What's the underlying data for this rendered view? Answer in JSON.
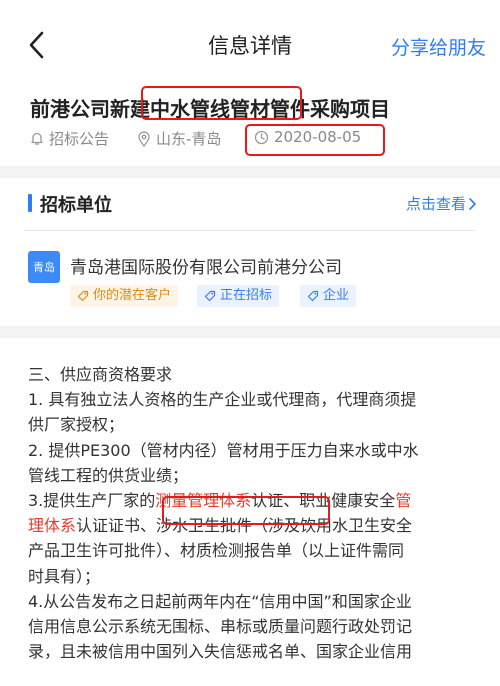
{
  "header": {
    "title": "信息详情",
    "share_label": "分享给朋友"
  },
  "project": {
    "title_part1": "前港公司新建",
    "title_highlight": "中水管线管材管件",
    "title_part2": "采购项目",
    "type": "招标公告",
    "location": "山东-青岛",
    "date": "2020-08-05"
  },
  "unit": {
    "section_title": "招标单位",
    "more_label": "点击查看",
    "logo_text": "青岛",
    "company": "青岛港国际股份有限公司前港分公司",
    "tags": [
      "你的潜在客户",
      "正在招标",
      "企业"
    ]
  },
  "body": {
    "heading": "三、供应商资格要求",
    "l1": "1. 具有独立法人资格的生产企业或代理商，代理商须提",
    "l2": "供厂家授权；",
    "l3": "2. 提供PE300（管材内径）管材用于压力自来水或中水",
    "l4": "管线工程的供货业绩；",
    "l5_a": "3.提供生产厂家的",
    "l5_red1": "测量管理体系",
    "l5_b": "认证、职业健康安全",
    "l5_red2": "管",
    "l6_red": "理体系",
    "l6_b": "认证证书、涉水卫生批件（涉及饮用水卫生安全",
    "l7": "产品卫生许可批件）、材质检测报告单（以上证件需同",
    "l8": "时具有）；",
    "l9": "4.从公告发布之日起前两年内在“信用中国”和国家企业",
    "l10": "信用信息公示系统无围标、串标或质量问题行政处罚记",
    "l11": "录，且未被信用中国列入失信惩戒名单、国家企业信用"
  },
  "colors": {
    "accent": "#2f7df6",
    "highlight_box": "#e21b1b",
    "highlight_text": "#e43c2e",
    "tag_orange": "#e08a1c"
  },
  "icons": [
    "back-icon",
    "bell-icon",
    "location-icon",
    "clock-icon",
    "chevron-right-icon",
    "tag-icon"
  ]
}
